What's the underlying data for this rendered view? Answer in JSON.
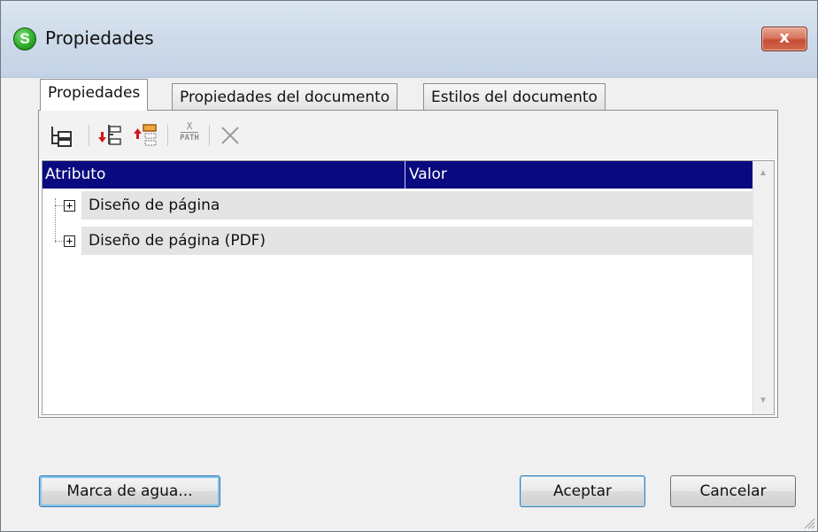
{
  "window": {
    "title": "Propiedades",
    "app_icon_letter": "S",
    "close_symbol": "x"
  },
  "tabs": [
    {
      "label": "Propiedades",
      "active": true
    },
    {
      "label": "Propiedades del documento",
      "active": false
    },
    {
      "label": "Estilos del documento",
      "active": false
    }
  ],
  "toolbar": {
    "icons": [
      "tree-view-icon",
      "insert-before-icon",
      "append-child-icon",
      "xpath-icon",
      "delete-icon"
    ],
    "xpath_top": "X",
    "xpath_bottom": "PATH"
  },
  "grid": {
    "columns": [
      "Atributo",
      "Valor"
    ],
    "rows": [
      {
        "label": "Diseño de página",
        "expander": "+"
      },
      {
        "label": "Diseño de página (PDF)",
        "expander": "+"
      }
    ]
  },
  "buttons": {
    "watermark": "Marca de agua...",
    "accept": "Aceptar",
    "cancel": "Cancelar"
  },
  "colors": {
    "header_bg": "#0a0a80",
    "row_bg": "#e4e4e4",
    "close_red": "#c74d33"
  }
}
